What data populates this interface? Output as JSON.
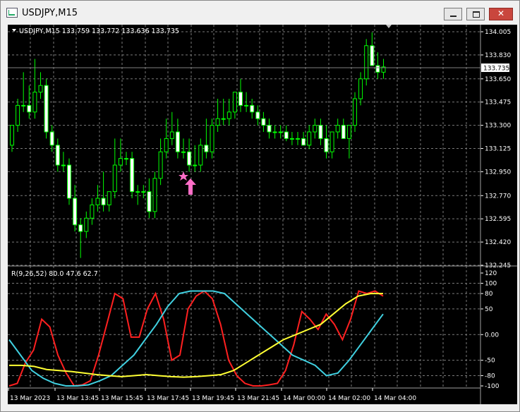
{
  "window": {
    "title": "USDJPY,M15"
  },
  "main_panel": {
    "header": "USDJPY,M15  133.759 133.772 133.636 133.735",
    "current_price": "133.735",
    "price_ticks": [
      "134.005",
      "133.830",
      "133.650",
      "133.475",
      "133.300",
      "133.125",
      "132.950",
      "132.770",
      "132.595",
      "132.420",
      "132.245"
    ]
  },
  "indicator_panel": {
    "header": "R(9,26,52) 80.0 47.6 62.7",
    "ticks": [
      "120",
      "100",
      "80",
      "50",
      "0.00",
      "-50",
      "-80",
      "-100"
    ]
  },
  "time_axis": [
    "13 Mar 2023",
    "13 Mar 13:45",
    "13 Mar 15:45",
    "13 Mar 17:45",
    "13 Mar 19:45",
    "13 Mar 21:45",
    "14 Mar 00:00",
    "14 Mar 02:00",
    "14 Mar 04:00"
  ],
  "colors": {
    "candle": "#00ff00",
    "indicator_fast": "#ff2020",
    "indicator_mid": "#40d0e0",
    "indicator_slow": "#ffff33",
    "marker": "#ff6ec7"
  },
  "chart_data": [
    {
      "type": "candlestick",
      "title": "USDJPY,M15",
      "ylim": [
        132.245,
        134.005
      ],
      "open": [
        133.15,
        133.3,
        133.45,
        133.45,
        133.4,
        133.55,
        133.6,
        133.25,
        133.15,
        133.0,
        133.0,
        132.75,
        132.55,
        132.5,
        132.6,
        132.7,
        132.75,
        132.7,
        132.8,
        133.0,
        133.05,
        133.05,
        132.8,
        132.8,
        132.8,
        132.65,
        132.9,
        133.1,
        133.2,
        133.25,
        133.1,
        133.1,
        133.0,
        133.0,
        133.15,
        133.1,
        133.3,
        133.35,
        133.35,
        133.4,
        133.55,
        133.45,
        133.45,
        133.4,
        133.35,
        133.3,
        133.25,
        133.25,
        133.25,
        133.2,
        133.2,
        133.2,
        133.15,
        133.25,
        133.3,
        133.2,
        133.1,
        133.25,
        133.3,
        133.2,
        133.3,
        133.5,
        133.65,
        133.9,
        133.75,
        133.7
      ],
      "high": [
        133.3,
        133.5,
        133.7,
        133.6,
        133.8,
        133.7,
        133.65,
        133.3,
        133.2,
        133.1,
        133.05,
        132.85,
        132.6,
        132.65,
        132.75,
        132.85,
        132.95,
        132.8,
        133.2,
        133.2,
        133.1,
        133.1,
        132.85,
        132.85,
        132.9,
        132.95,
        133.2,
        133.35,
        133.4,
        133.35,
        133.2,
        133.2,
        133.15,
        133.2,
        133.35,
        133.35,
        133.5,
        133.5,
        133.5,
        133.55,
        133.65,
        133.55,
        133.5,
        133.45,
        133.4,
        133.35,
        133.3,
        133.3,
        133.3,
        133.25,
        133.25,
        133.25,
        133.3,
        133.35,
        133.35,
        133.3,
        133.25,
        133.35,
        133.35,
        133.3,
        133.55,
        133.7,
        133.95,
        134.0,
        133.85,
        133.8
      ],
      "low": [
        133.1,
        133.25,
        133.4,
        133.35,
        133.35,
        133.5,
        133.2,
        133.1,
        132.95,
        132.95,
        132.7,
        132.5,
        132.3,
        132.45,
        132.55,
        132.65,
        132.65,
        132.65,
        132.75,
        132.95,
        133.0,
        132.75,
        132.7,
        132.75,
        132.6,
        132.6,
        132.85,
        133.05,
        133.15,
        133.05,
        133.05,
        132.95,
        132.95,
        132.95,
        133.05,
        133.05,
        133.25,
        133.3,
        133.3,
        133.35,
        133.4,
        133.4,
        133.35,
        133.3,
        133.25,
        133.2,
        133.2,
        133.2,
        133.18,
        133.15,
        133.15,
        133.15,
        133.12,
        133.2,
        133.15,
        133.05,
        133.05,
        133.2,
        133.2,
        133.05,
        133.25,
        133.45,
        133.6,
        133.8,
        133.65,
        133.65
      ],
      "close": [
        133.3,
        133.45,
        133.45,
        133.4,
        133.55,
        133.6,
        133.25,
        133.15,
        133.0,
        133.0,
        132.75,
        132.55,
        132.5,
        132.6,
        132.7,
        132.75,
        132.7,
        132.8,
        133.0,
        133.05,
        133.05,
        132.8,
        132.8,
        132.8,
        132.65,
        132.9,
        133.1,
        133.2,
        133.25,
        133.1,
        133.1,
        133.0,
        133.0,
        133.15,
        133.1,
        133.3,
        133.35,
        133.35,
        133.4,
        133.55,
        133.45,
        133.45,
        133.4,
        133.35,
        133.3,
        133.25,
        133.25,
        133.25,
        133.2,
        133.2,
        133.2,
        133.15,
        133.25,
        133.3,
        133.2,
        133.1,
        133.25,
        133.3,
        133.2,
        133.3,
        133.5,
        133.65,
        133.9,
        133.75,
        133.7,
        133.74
      ]
    },
    {
      "type": "line",
      "title": "R(9,26,52) 80.0 47.6 62.7",
      "ylim": [
        -100,
        120
      ],
      "series": [
        {
          "values": [
            -100,
            -95,
            -55,
            -30,
            30,
            15,
            -40,
            -75,
            -100,
            -98,
            -90,
            -40,
            20,
            80,
            70,
            -5,
            -5,
            50,
            80,
            30,
            -50,
            -40,
            50,
            75,
            85,
            70,
            20,
            -50,
            -80,
            -95,
            -100,
            -100,
            -98,
            -95,
            -70,
            -20,
            45,
            30,
            10,
            40,
            20,
            -10,
            30,
            85,
            80,
            85,
            75
          ]
        },
        {
          "values": [
            -10,
            -40,
            -70,
            -85,
            -95,
            -100,
            -100,
            -98,
            -90,
            -80,
            -60,
            -40,
            -10,
            20,
            55,
            80,
            85,
            85,
            85,
            80,
            60,
            40,
            20,
            0,
            -20,
            -40,
            -50,
            -60,
            -80,
            -75,
            -50,
            -20,
            10,
            40
          ]
        },
        {
          "values": [
            -60,
            -60,
            -62,
            -68,
            -70,
            -72,
            -75,
            -78,
            -80,
            -82,
            -80,
            -78,
            -80,
            -82,
            -83,
            -82,
            -80,
            -78,
            -70,
            -55,
            -40,
            -25,
            -10,
            0,
            10,
            20,
            40,
            60,
            75,
            80,
            80
          ]
        }
      ]
    }
  ]
}
